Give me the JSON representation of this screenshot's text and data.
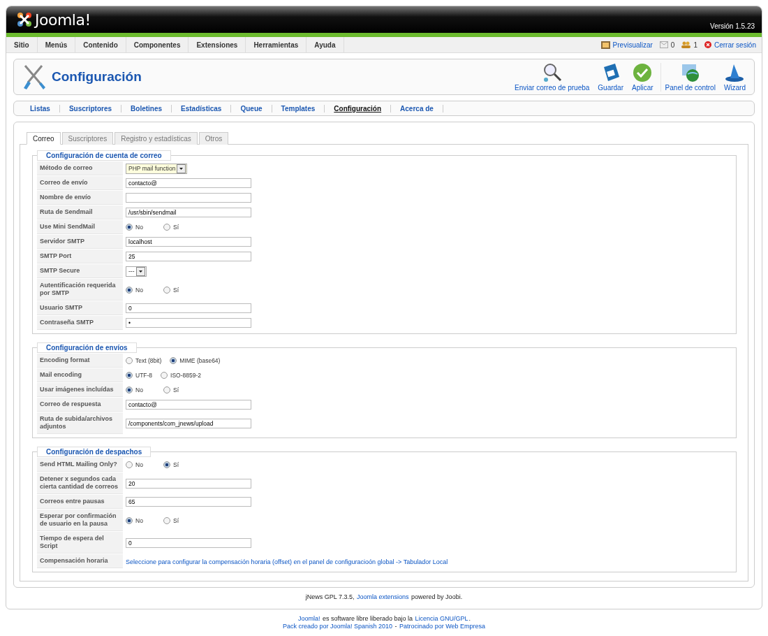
{
  "header": {
    "logo_text": "Joomla!",
    "version": "Versión 1.5.23"
  },
  "menu": [
    "Sitio",
    "Menús",
    "Contenido",
    "Componentes",
    "Extensiones",
    "Herramientas",
    "Ayuda"
  ],
  "status": {
    "preview": "Previsualizar",
    "messages": "0",
    "users": "1",
    "logout": "Cerrar sesión"
  },
  "toolbar": {
    "title": "Configuración",
    "buttons": [
      {
        "label": "Enviar correo de prueba",
        "kind": "search"
      },
      {
        "label": "Guardar",
        "kind": "save"
      },
      {
        "label": "Aplicar",
        "kind": "apply"
      },
      {
        "label": "Panel de control",
        "kind": "panel"
      },
      {
        "label": "Wizard",
        "kind": "wizard"
      }
    ]
  },
  "submenu": [
    {
      "label": "Listas",
      "selected": false
    },
    {
      "label": "Suscriptores",
      "selected": false
    },
    {
      "label": "Boletines",
      "selected": false
    },
    {
      "label": "Estadísticas",
      "selected": false
    },
    {
      "label": "Queue",
      "selected": false
    },
    {
      "label": "Templates",
      "selected": false
    },
    {
      "label": "Configuración",
      "selected": true
    },
    {
      "label": "Acerca de",
      "selected": false
    }
  ],
  "tabs": [
    {
      "label": "Correo",
      "selected": true
    },
    {
      "label": "Suscriptores",
      "selected": false
    },
    {
      "label": "Registro y estadísticas",
      "selected": false
    },
    {
      "label": "Otros",
      "selected": false
    }
  ],
  "sections": [
    {
      "title": "Configuración de cuenta de correo",
      "rows": [
        {
          "label": "Método de correo",
          "kind": "select",
          "value": "PHP mail function",
          "highlight": true
        },
        {
          "label": "Correo de envío",
          "kind": "text",
          "value": "contacto@"
        },
        {
          "label": "Nombre de envío",
          "kind": "text"
        },
        {
          "label": "Ruta de Sendmail",
          "kind": "text",
          "value": "/usr/sbin/sendmail"
        },
        {
          "label": "Use Mini SendMail",
          "kind": "radio",
          "options": [
            {
              "label": "No",
              "selected": true
            },
            {
              "label": "Sí",
              "selected": false
            }
          ]
        },
        {
          "label": "Servidor SMTP",
          "kind": "text",
          "value": "localhost"
        },
        {
          "label": "SMTP Port",
          "kind": "text",
          "value": "25"
        },
        {
          "label": "SMTP Secure",
          "kind": "select",
          "value": "---",
          "highlight": false
        },
        {
          "label": "Autentificación requerida por SMTP",
          "kind": "radio",
          "options": [
            {
              "label": "No",
              "selected": true
            },
            {
              "label": "Sí",
              "selected": false
            }
          ]
        },
        {
          "label": "Usuario SMTP",
          "kind": "text",
          "value": "0"
        },
        {
          "label": "Contraseña SMTP",
          "kind": "text",
          "value": "•"
        }
      ]
    },
    {
      "title": "Configuración de envíos",
      "rows": [
        {
          "label": "Encoding format",
          "kind": "radio",
          "options": [
            {
              "label": "Text (8bit)",
              "selected": false
            },
            {
              "label": "MIME (base64)",
              "selected": true
            }
          ]
        },
        {
          "label": "Mail encoding",
          "kind": "radio",
          "options": [
            {
              "label": "UTF-8",
              "selected": true
            },
            {
              "label": "ISO-8859-2",
              "selected": false
            }
          ]
        },
        {
          "label": "Usar imágenes incluídas",
          "kind": "radio",
          "options": [
            {
              "label": "No",
              "selected": true
            },
            {
              "label": "Sí",
              "selected": false
            }
          ]
        },
        {
          "label": "Correo de respuesta",
          "kind": "text",
          "value": "contacto@"
        },
        {
          "label": "Ruta de subida/archivos adjuntos",
          "kind": "text",
          "value": "/components/com_jnews/upload"
        }
      ]
    },
    {
      "title": "Configuración de despachos",
      "rows": [
        {
          "label": "Send HTML Mailing Only?",
          "kind": "radio",
          "options": [
            {
              "label": "No",
              "selected": false
            },
            {
              "label": "Sí",
              "selected": true
            }
          ]
        },
        {
          "label": "Detener x segundos cada cierta cantidad de correos",
          "kind": "text",
          "value": "20"
        },
        {
          "label": "Correos entre pausas",
          "kind": "text",
          "value": "65"
        },
        {
          "label": "Esperar por confirmación de usuario en la pausa",
          "kind": "radio",
          "options": [
            {
              "label": "No",
              "selected": true
            },
            {
              "label": "Sí",
              "selected": false
            }
          ]
        },
        {
          "label": "Tiempo de espera del Script",
          "kind": "text",
          "value": "0"
        },
        {
          "label": "Compensación horaria",
          "kind": "link",
          "value": "Seleccione para configurar la compensación horaria (offset) en el panel de configuracioón global -> Tabulador Local"
        }
      ]
    }
  ],
  "credits": [
    {
      "text": "jNews GPL 7.3.5, ",
      "link": false
    },
    {
      "text": "Joomla extensions",
      "link": true
    },
    {
      "text": " powered by Joobi.",
      "link": false
    }
  ],
  "footer": [
    [
      {
        "text": "Joomla!",
        "link": true
      },
      {
        "text": " es software libre liberado bajo la ",
        "link": false
      },
      {
        "text": "Licencia GNU/GPL",
        "link": true
      },
      {
        "text": ".",
        "link": false
      }
    ],
    [
      {
        "text": "Pack creado por Joomla! Spanish 2010",
        "link": true
      },
      {
        "text": " - ",
        "link": false
      },
      {
        "text": "Patrocinado por Web Empresa",
        "link": true
      }
    ]
  ]
}
